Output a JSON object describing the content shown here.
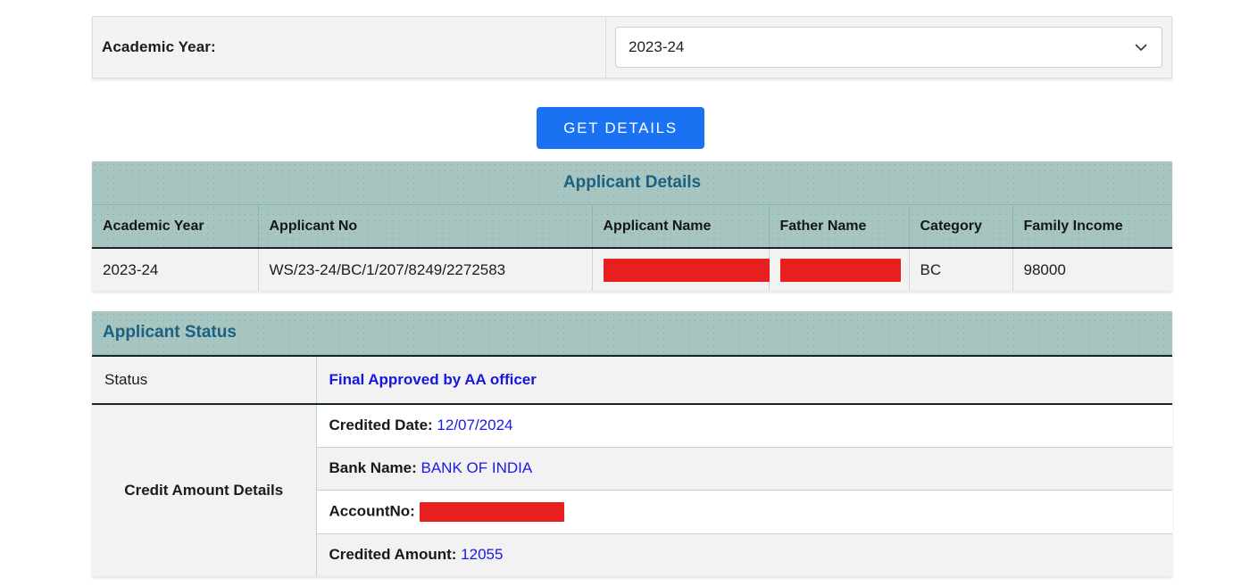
{
  "filter": {
    "label": "Academic Year:",
    "selected_year": "2023-24",
    "caret_icon": "chevron-down-icon"
  },
  "actions": {
    "get_details_label": "GET DETAILS"
  },
  "applicant_details": {
    "title": "Applicant Details",
    "columns": [
      "Academic Year",
      "Applicant No",
      "Applicant Name",
      "Father Name",
      "Category",
      "Family Income"
    ],
    "rows": [
      {
        "academic_year": "2023-24",
        "applicant_no": "WS/23-24/BC/1/207/8249/2272583",
        "applicant_name": "",
        "father_name": "",
        "category": "BC",
        "family_income": "98000"
      }
    ]
  },
  "applicant_status": {
    "title": "Applicant Status",
    "status_label": "Status",
    "status_value": "Final Approved by AA officer",
    "credit_label": "Credit Amount Details",
    "credit_rows": [
      {
        "key": "Credited Date:",
        "value": "12/07/2024",
        "redacted": false
      },
      {
        "key": "Bank Name:",
        "value": "BANK OF INDIA",
        "redacted": false
      },
      {
        "key": "AccountNo:",
        "value": "",
        "redacted": true
      },
      {
        "key": "Credited Amount:",
        "value": "12055",
        "redacted": false
      }
    ]
  },
  "colors": {
    "header_teal": "#a7c5c1",
    "header_text": "#1c6180",
    "accent_blue": "#1a72f2",
    "value_blue": "#1a1ae6",
    "redaction_red": "#e81f1f",
    "row_gray": "#f2f2f2"
  }
}
